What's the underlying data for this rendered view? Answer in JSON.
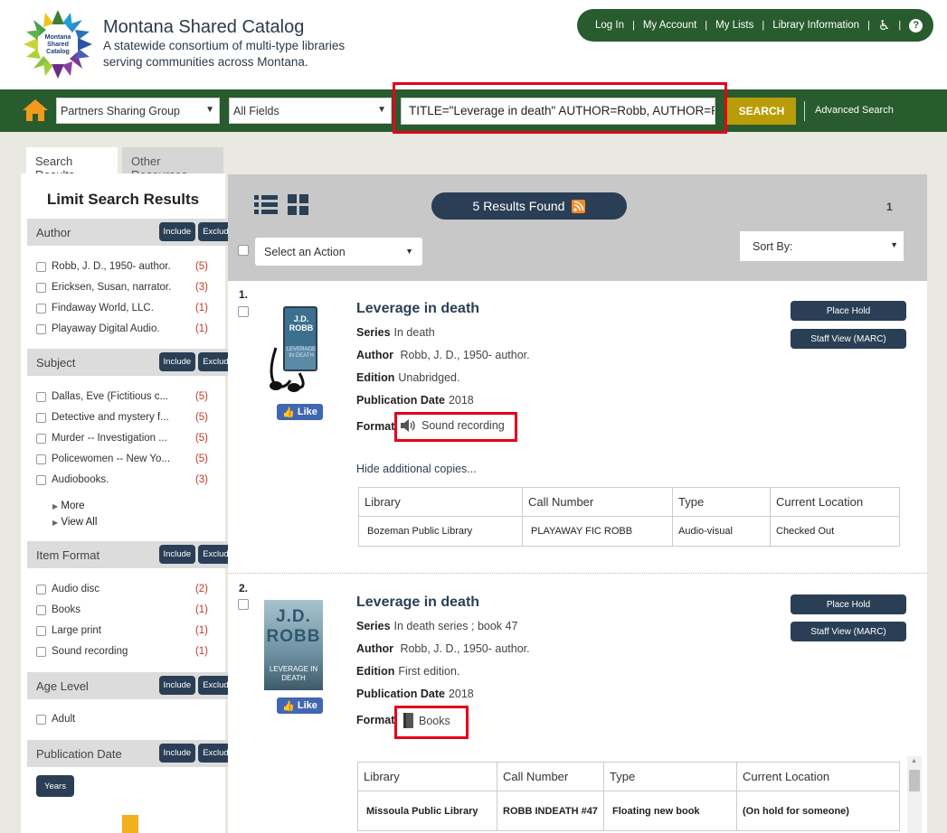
{
  "header": {
    "title": "Montana Shared Catalog",
    "subtitle": "A statewide consortium of multi-type libraries serving communities across Montana.",
    "logo_text": "Montana Shared Catalog",
    "links": [
      "Log In",
      "My Account",
      "My Lists",
      "Library Information"
    ],
    "help_label": "?"
  },
  "search": {
    "scope": "Partners Sharing Group",
    "field": "All Fields",
    "query": "TITLE=\"Leverage in death\" AUTHOR=Robb, AUTHOR=Robb",
    "button": "SEARCH",
    "advanced": "Advanced Search"
  },
  "tabs": [
    "Search Results",
    "Other Resources"
  ],
  "sidebar": {
    "title": "Limit Search Results",
    "include": "Include",
    "exclude": "Exclude",
    "facets": [
      {
        "name": "Author",
        "items": [
          {
            "label": "Robb, J. D., 1950- author.",
            "count": "(5)"
          },
          {
            "label": "Ericksen, Susan, narrator.",
            "count": "(3)"
          },
          {
            "label": "Findaway World, LLC.",
            "count": "(1)"
          },
          {
            "label": "Playaway Digital Audio.",
            "count": "(1)"
          }
        ]
      },
      {
        "name": "Subject",
        "items": [
          {
            "label": "Dallas, Eve (Fictitious c...",
            "count": "(5)"
          },
          {
            "label": "Detective and mystery f...",
            "count": "(5)"
          },
          {
            "label": "Murder -- Investigation ...",
            "count": "(5)"
          },
          {
            "label": "Policewomen -- New Yo...",
            "count": "(5)"
          },
          {
            "label": "Audiobooks.",
            "count": "(3)"
          }
        ]
      },
      {
        "name": "Item Format",
        "items": [
          {
            "label": "Audio disc",
            "count": "(2)"
          },
          {
            "label": "Books",
            "count": "(1)"
          },
          {
            "label": "Large print",
            "count": "(1)"
          },
          {
            "label": "Sound recording",
            "count": "(1)"
          }
        ]
      },
      {
        "name": "Age Level",
        "items": [
          {
            "label": "Adult",
            "count": ""
          }
        ]
      },
      {
        "name": "Publication Date",
        "items": []
      }
    ],
    "more": "More",
    "view_all": "View All",
    "years": "Years"
  },
  "results_header": {
    "count": "5 Results Found",
    "page": "1",
    "action": "Select an Action",
    "sort": "Sort By:"
  },
  "records": [
    {
      "num": "1.",
      "title": "Leverage in death",
      "series_label": "Series",
      "series": "In death",
      "author_label": "Author",
      "author": "Robb, J. D., 1950- author.",
      "edition_label": "Edition",
      "edition": "Unabridged.",
      "pubdate_label": "Publication Date",
      "pubdate": "2018",
      "format_label": "Format",
      "format": "Sound recording",
      "cover_author": "J.D. ROBB",
      "cover_title": "LEVERAGE IN DEATH",
      "like": "Like",
      "place_hold": "Place Hold",
      "staff_view": "Staff View (MARC)",
      "hide_copies": "Hide additional copies...",
      "copies_head": [
        "Library",
        "Call Number",
        "Type",
        "Current Location"
      ],
      "copies": [
        [
          "Bozeman Public Library",
          "PLAYAWAY FIC ROBB",
          "Audio-visual",
          "Checked Out"
        ]
      ]
    },
    {
      "num": "2.",
      "title": "Leverage in death",
      "series_label": "Series",
      "series": "In death series ; book 47",
      "author_label": "Author",
      "author": "Robb, J. D., 1950- author.",
      "edition_label": "Edition",
      "edition": "First edition.",
      "pubdate_label": "Publication Date",
      "pubdate": "2018",
      "format_label": "Format",
      "format": "Books",
      "cover_author": "J.D. ROBB",
      "cover_title": "LEVERAGE IN DEATH",
      "like": "Like",
      "place_hold": "Place Hold",
      "staff_view": "Staff View (MARC)",
      "copies_head": [
        "Library",
        "Call Number",
        "Type",
        "Current Location"
      ],
      "copies": [
        [
          "Missoula Public Library",
          "ROBB INDEATH #47",
          "Floating new book",
          "(On hold for someone)"
        ]
      ]
    }
  ],
  "colors": {
    "green": "#285b2d",
    "navy": "#2a3f56",
    "gold": "#b89d08",
    "highlight": "#e3001b"
  }
}
